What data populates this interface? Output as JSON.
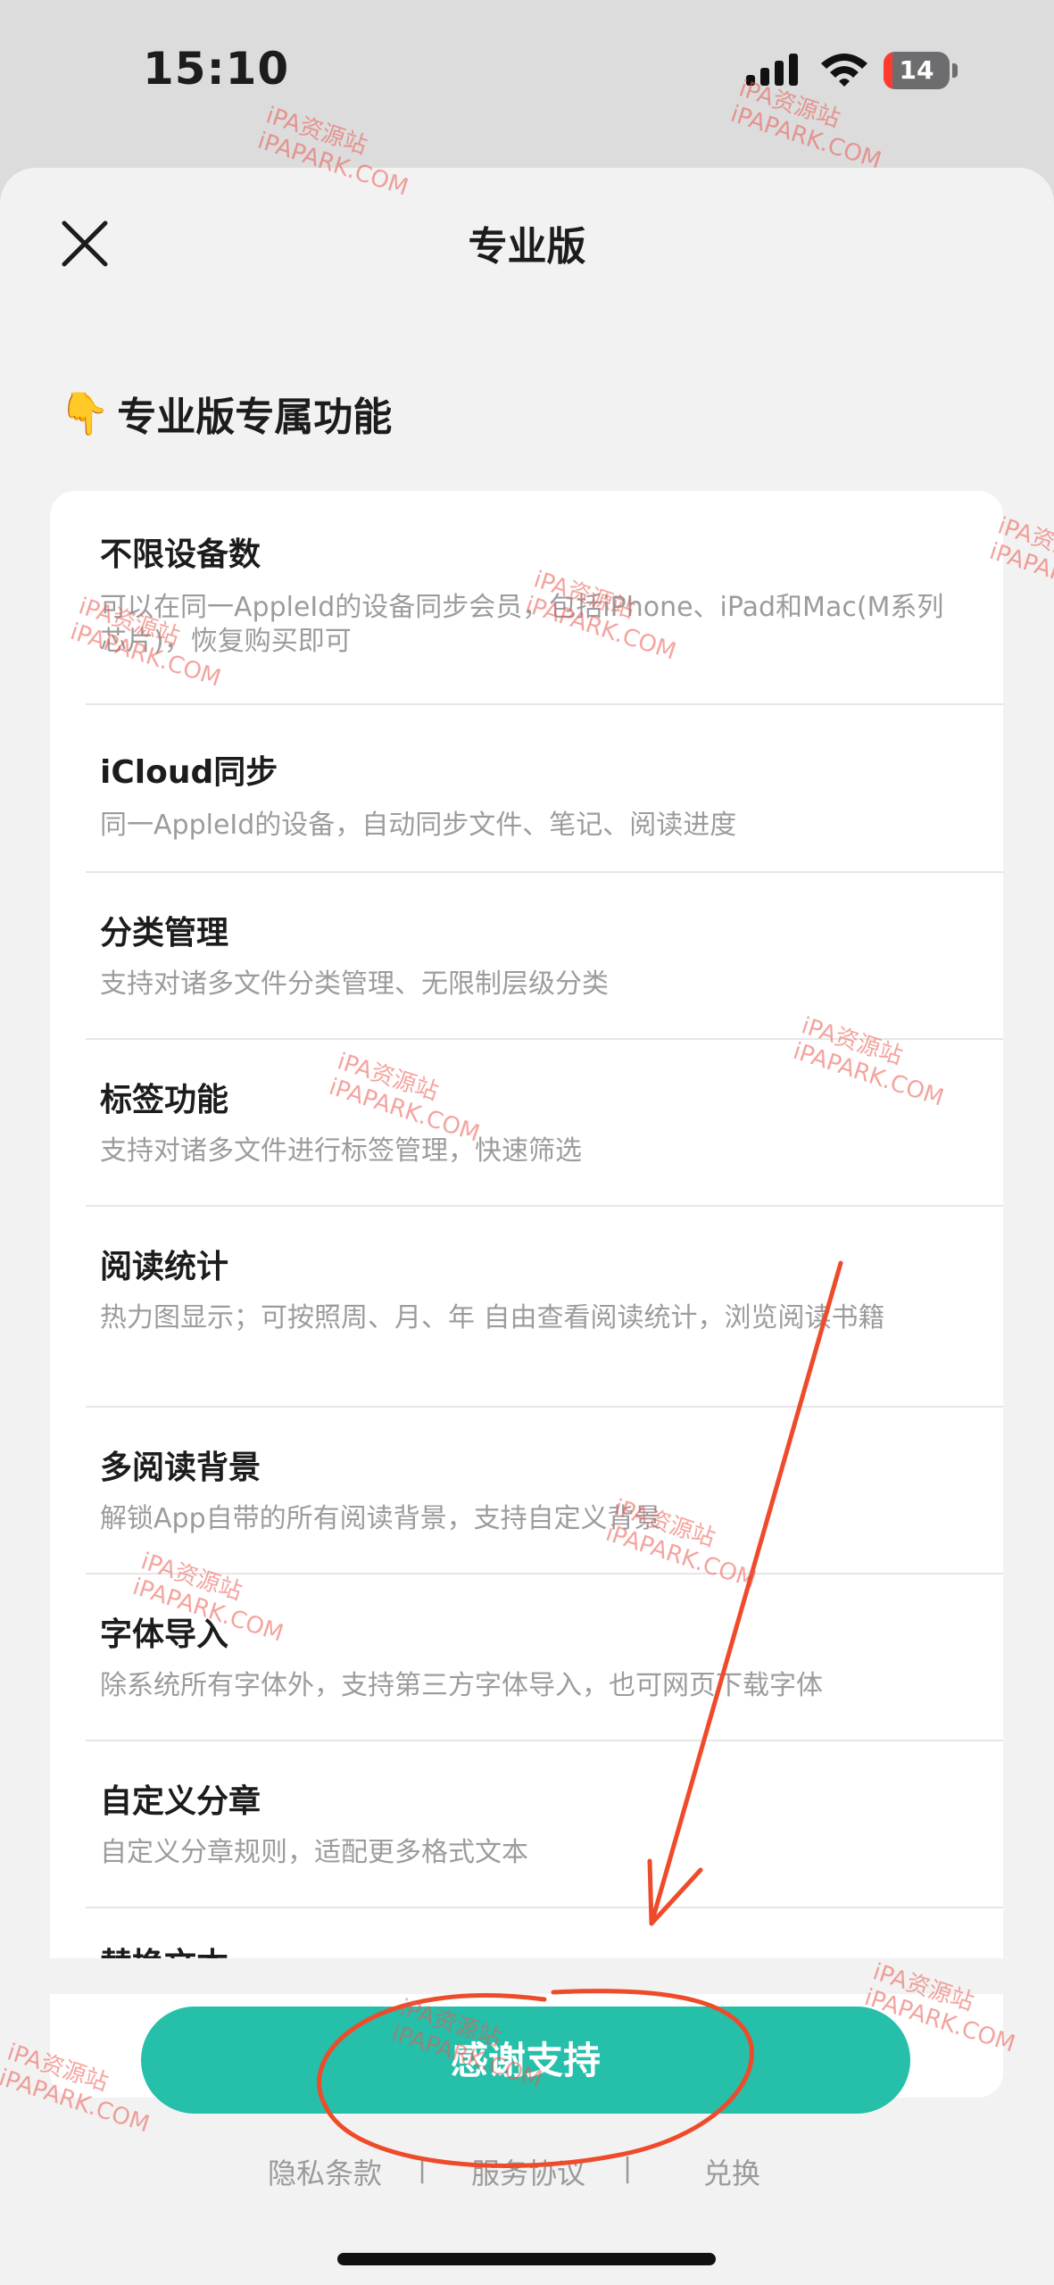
{
  "status_bar": {
    "time": "15:10",
    "battery_level": "14",
    "battery_fraction": 0.14,
    "battery_color": "#ff3b30"
  },
  "sheet": {
    "title": "专业版",
    "close_icon": "close-icon",
    "section_title": "专业版专属功能",
    "section_icon": "👇"
  },
  "features": [
    {
      "title": "不限设备数",
      "desc": "可以在同一AppleId的设备同步会员，包括iPhone、iPad和Mac(M系列芯片)，恢复购买即可"
    },
    {
      "title": "iCloud同步",
      "desc": "同一AppleId的设备，自动同步文件、笔记、阅读进度"
    },
    {
      "title": "分类管理",
      "desc": "支持对诸多文件分类管理、无限制层级分类"
    },
    {
      "title": "标签功能",
      "desc": "支持对诸多文件进行标签管理，快速筛选"
    },
    {
      "title": "阅读统计",
      "desc": "热力图显示；可按照周、月、年 自由查看阅读统计，浏览阅读书籍"
    },
    {
      "title": "多阅读背景",
      "desc": "解锁App自带的所有阅读背景，支持自定义背景"
    },
    {
      "title": "字体导入",
      "desc": "除系统所有字体外，支持第三方字体导入，也可网页下载字体"
    },
    {
      "title": "自定义分章",
      "desc": "自定义分章规则，适配更多格式文本"
    },
    {
      "title": "替换文本",
      "desc": ""
    }
  ],
  "actions": {
    "thanks_button": "感谢支持",
    "accent_color": "#25bfaa"
  },
  "footer": {
    "privacy": "隐私条款",
    "terms": "服务协议",
    "redeem": "兑换",
    "separator": "|"
  },
  "watermark": {
    "line1": "iPA资源站",
    "line2": "iPAPARK.COM"
  }
}
